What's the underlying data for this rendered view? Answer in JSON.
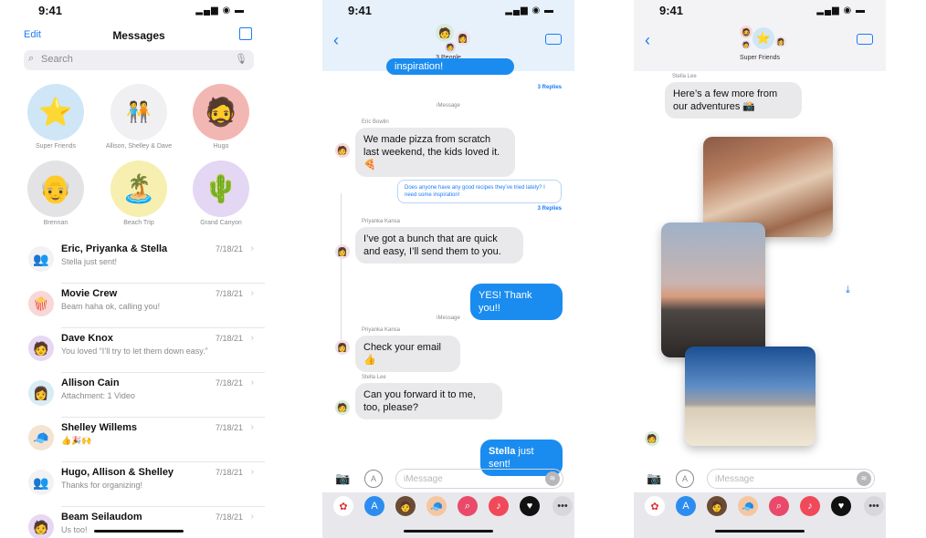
{
  "status_time": "9:41",
  "list_screen": {
    "nav": {
      "edit": "Edit",
      "title": "Messages"
    },
    "search_placeholder": "Search",
    "pinned": [
      {
        "name": "Super Friends",
        "emoji": "⭐",
        "bg": "#cfe6f7"
      },
      {
        "name": "Allison, Shelley & Dave",
        "emoji": "🧑‍🤝‍🧑",
        "bg": "#f0f0f2"
      },
      {
        "name": "Hugo",
        "emoji": "🧔",
        "bg": "#f3b7b3"
      },
      {
        "name": "Brennan",
        "emoji": "👴",
        "bg": "#e3e3e6"
      },
      {
        "name": "Beach Trip",
        "emoji": "🏝️",
        "bg": "#f6efb0"
      },
      {
        "name": "Grand Canyon",
        "emoji": "🌵",
        "bg": "#e3d7f4"
      }
    ],
    "conversations": [
      {
        "name": "Eric, Priyanka & Stella",
        "preview": "Stella just sent!",
        "date": "7/18/21",
        "emoji": "👥",
        "bg": "#f2f2f4"
      },
      {
        "name": "Movie Crew",
        "preview": "Beam haha ok, calling you!",
        "date": "7/18/21",
        "emoji": "🍿",
        "bg": "#f7d7d7"
      },
      {
        "name": "Dave Knox",
        "preview": "You loved “I’ll try to let them down easy.”",
        "date": "7/18/21",
        "emoji": "🧑",
        "bg": "#e6d8f3"
      },
      {
        "name": "Allison Cain",
        "preview": "Attachment: 1 Video",
        "date": "7/18/21",
        "emoji": "👩",
        "bg": "#d7ecf5"
      },
      {
        "name": "Shelley Willems",
        "preview": "👍🎉🙌",
        "date": "7/18/21",
        "emoji": "🧢",
        "bg": "#f3e3d0"
      },
      {
        "name": "Hugo, Allison & Shelley",
        "preview": "Thanks for organizing!",
        "date": "7/18/21",
        "emoji": "👥",
        "bg": "#f2f2f4"
      },
      {
        "name": "Beam Seilaudom",
        "preview": "Us too!",
        "date": "7/18/21",
        "emoji": "🧑",
        "bg": "#e6d8f3"
      }
    ]
  },
  "group_chat": {
    "header": "3 People",
    "top_bubble": "inspiration!",
    "replies_1": "3 Replies",
    "service_1": "iMessage",
    "sender_1": "Eric Bowlin",
    "msg_1": "We made pizza from scratch last weekend, the kids loved it. 🍕",
    "quote": "Does anyone have any good recipes they’ve tried lately? I need some inspiration!",
    "replies_2": "3 Replies",
    "sender_2": "Priyanka Kansa",
    "msg_2": "I’ve got a bunch that are quick and easy, I’ll send them to you.",
    "msg_3": "YES!  Thank you!!",
    "service_2": "iMessage",
    "sender_3": "Priyanka Kansa",
    "msg_4": "Check your email 👍",
    "sender_4": "Stella Lee",
    "msg_5": "Can you forward it to me, too, please?",
    "msg_6_bold": "Stella",
    "msg_6_rest": " just sent!",
    "composer_placeholder": "iMessage"
  },
  "photo_chat": {
    "header": "Super Friends",
    "sender": "Stella Lee",
    "msg": "Here’s a few more from our adventures 📸",
    "composer_placeholder": "iMessage"
  },
  "colors": {
    "accent": "#1a7cf5",
    "outgoing": "#1a8cf0",
    "incoming": "#e9e9eb"
  }
}
